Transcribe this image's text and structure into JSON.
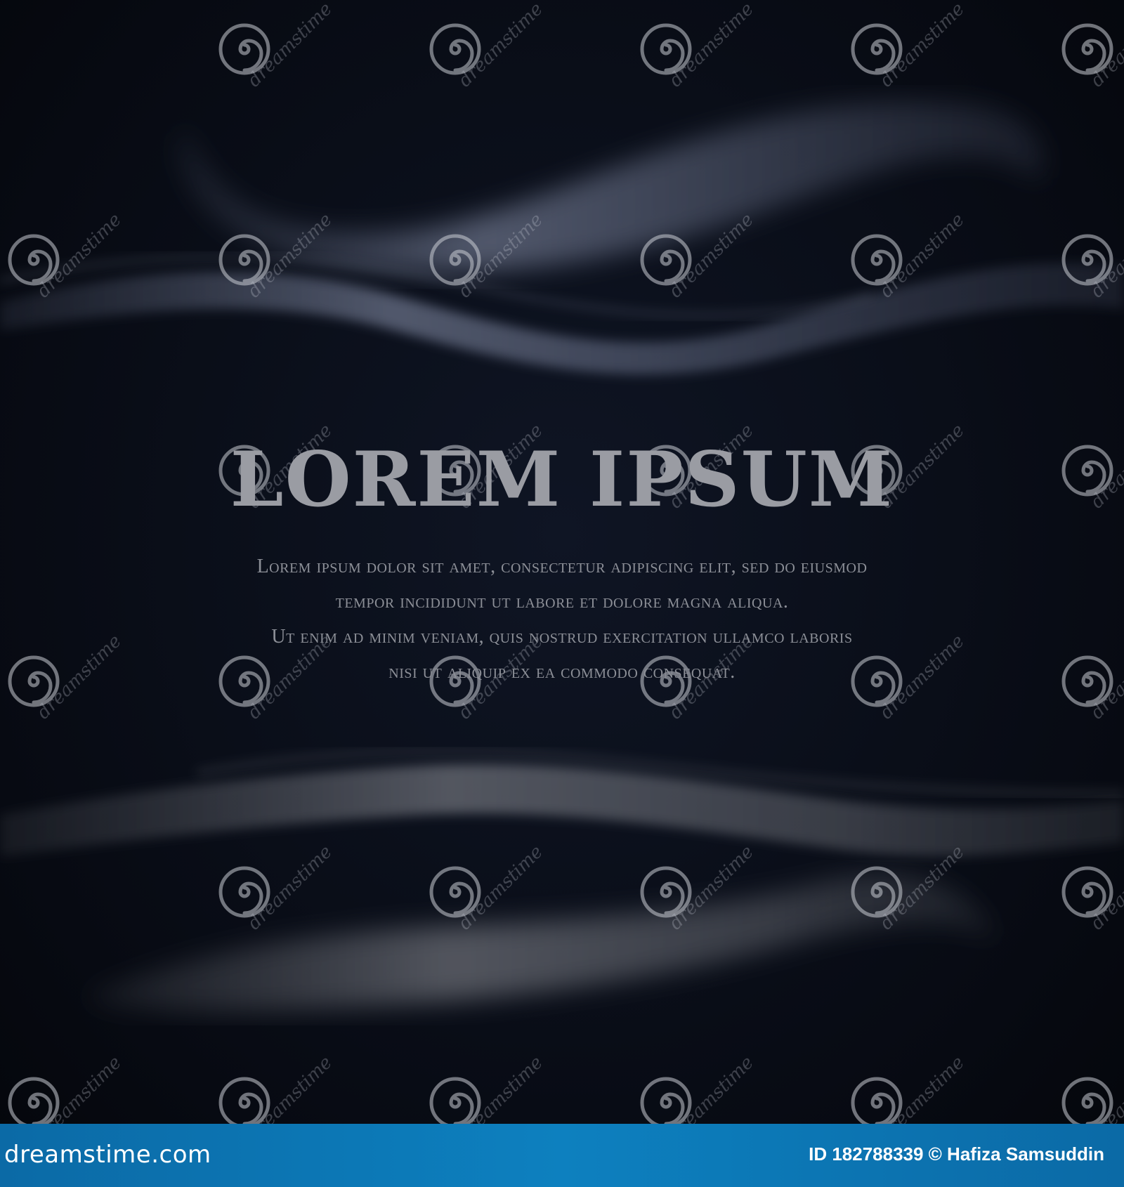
{
  "main": {
    "title": "LOREM IPSUM",
    "body_lines": [
      "Lorem ipsum dolor sit amet, consectetur adipiscing elit, sed do eiusmod",
      "tempor incididunt ut labore et dolore magna aliqua.",
      "Ut enim ad minim veniam, quis nostrud exercitation ullamco laboris",
      "nisi ut aliquip ex ea commodo consequat."
    ]
  },
  "watermark": {
    "text": "dreamstime",
    "icon": "spiral-icon"
  },
  "footer": {
    "brand": "dreamstime.com",
    "image_id": "ID 182788339 © Hafiza Samsuddin"
  },
  "colors": {
    "background": "#0b0f19",
    "smoke": "#8a93a8",
    "title": "#9a9ca3",
    "body_text": "#8c8f97",
    "footer_bar": "#0d80bf"
  }
}
